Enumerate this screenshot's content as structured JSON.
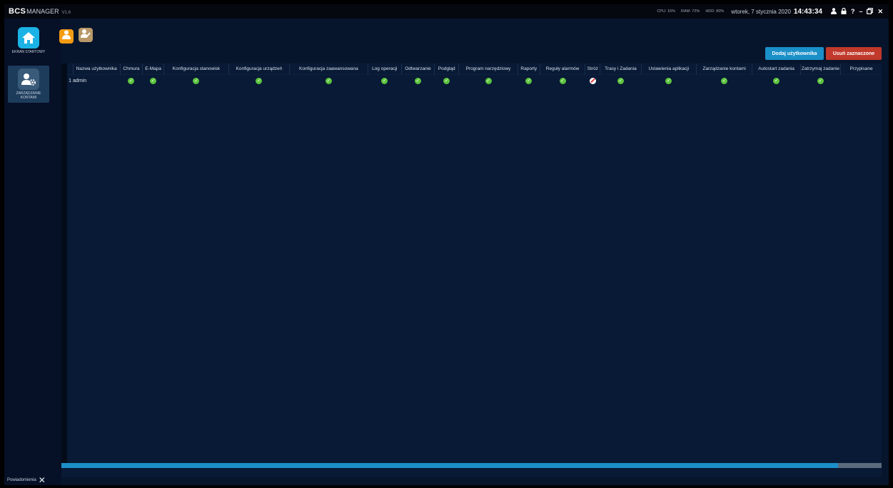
{
  "app": {
    "brand_bcs": "BCS",
    "brand_manager": "MANAGER",
    "version": "V1.6"
  },
  "system": {
    "cpu": "CPU: 16%",
    "ram": "RAM: 72%",
    "hdd": "HDD: 80%",
    "date": "wtorek, 7 stycznia 2020",
    "time": "14:43:34"
  },
  "titlebar_icons": [
    "user-icon",
    "lock-icon",
    "help-icon",
    "minimize-icon",
    "restore-icon",
    "close-icon"
  ],
  "sidebar": {
    "items": [
      {
        "label": "EKRAN STARTOWY",
        "icon": "home-icon"
      },
      {
        "label": "ZARZĄDZANIE KONTAMI",
        "icon": "user-settings-icon"
      }
    ]
  },
  "toolbar": {
    "add_user": "Dodaj użytkownika",
    "delete_selected": "Usuń zaznaczone"
  },
  "table": {
    "columns": [
      "Nazwa użytkownika",
      "Chmura",
      "E-Mapa",
      "Konfiguracja stanowisk",
      "Konfiguracja urządzeń",
      "Konfiguracja zaawansowana",
      "Log operacji",
      "Odtwarzanie",
      "Podgląd",
      "Program narzędziowy",
      "Raporty",
      "Reguły alarmów",
      "Stróż",
      "Trasy i Zadania",
      "Ustawienia aplikacji",
      "Zarządzanie kontami",
      "Autostart zadania",
      "Zatrzymaj zadanie",
      "Przypisane"
    ],
    "rows": [
      {
        "index": "1",
        "name": "admin",
        "permissions": [
          true,
          true,
          true,
          true,
          true,
          true,
          true,
          true,
          true,
          true,
          true,
          false,
          true,
          true,
          true,
          true,
          true,
          null
        ]
      }
    ]
  },
  "notifications": {
    "label": "Powiadomienia"
  },
  "colors": {
    "accent": "#1a8fc8",
    "danger": "#c0392b",
    "ok": "#5cc43d",
    "background": "#07152c"
  }
}
